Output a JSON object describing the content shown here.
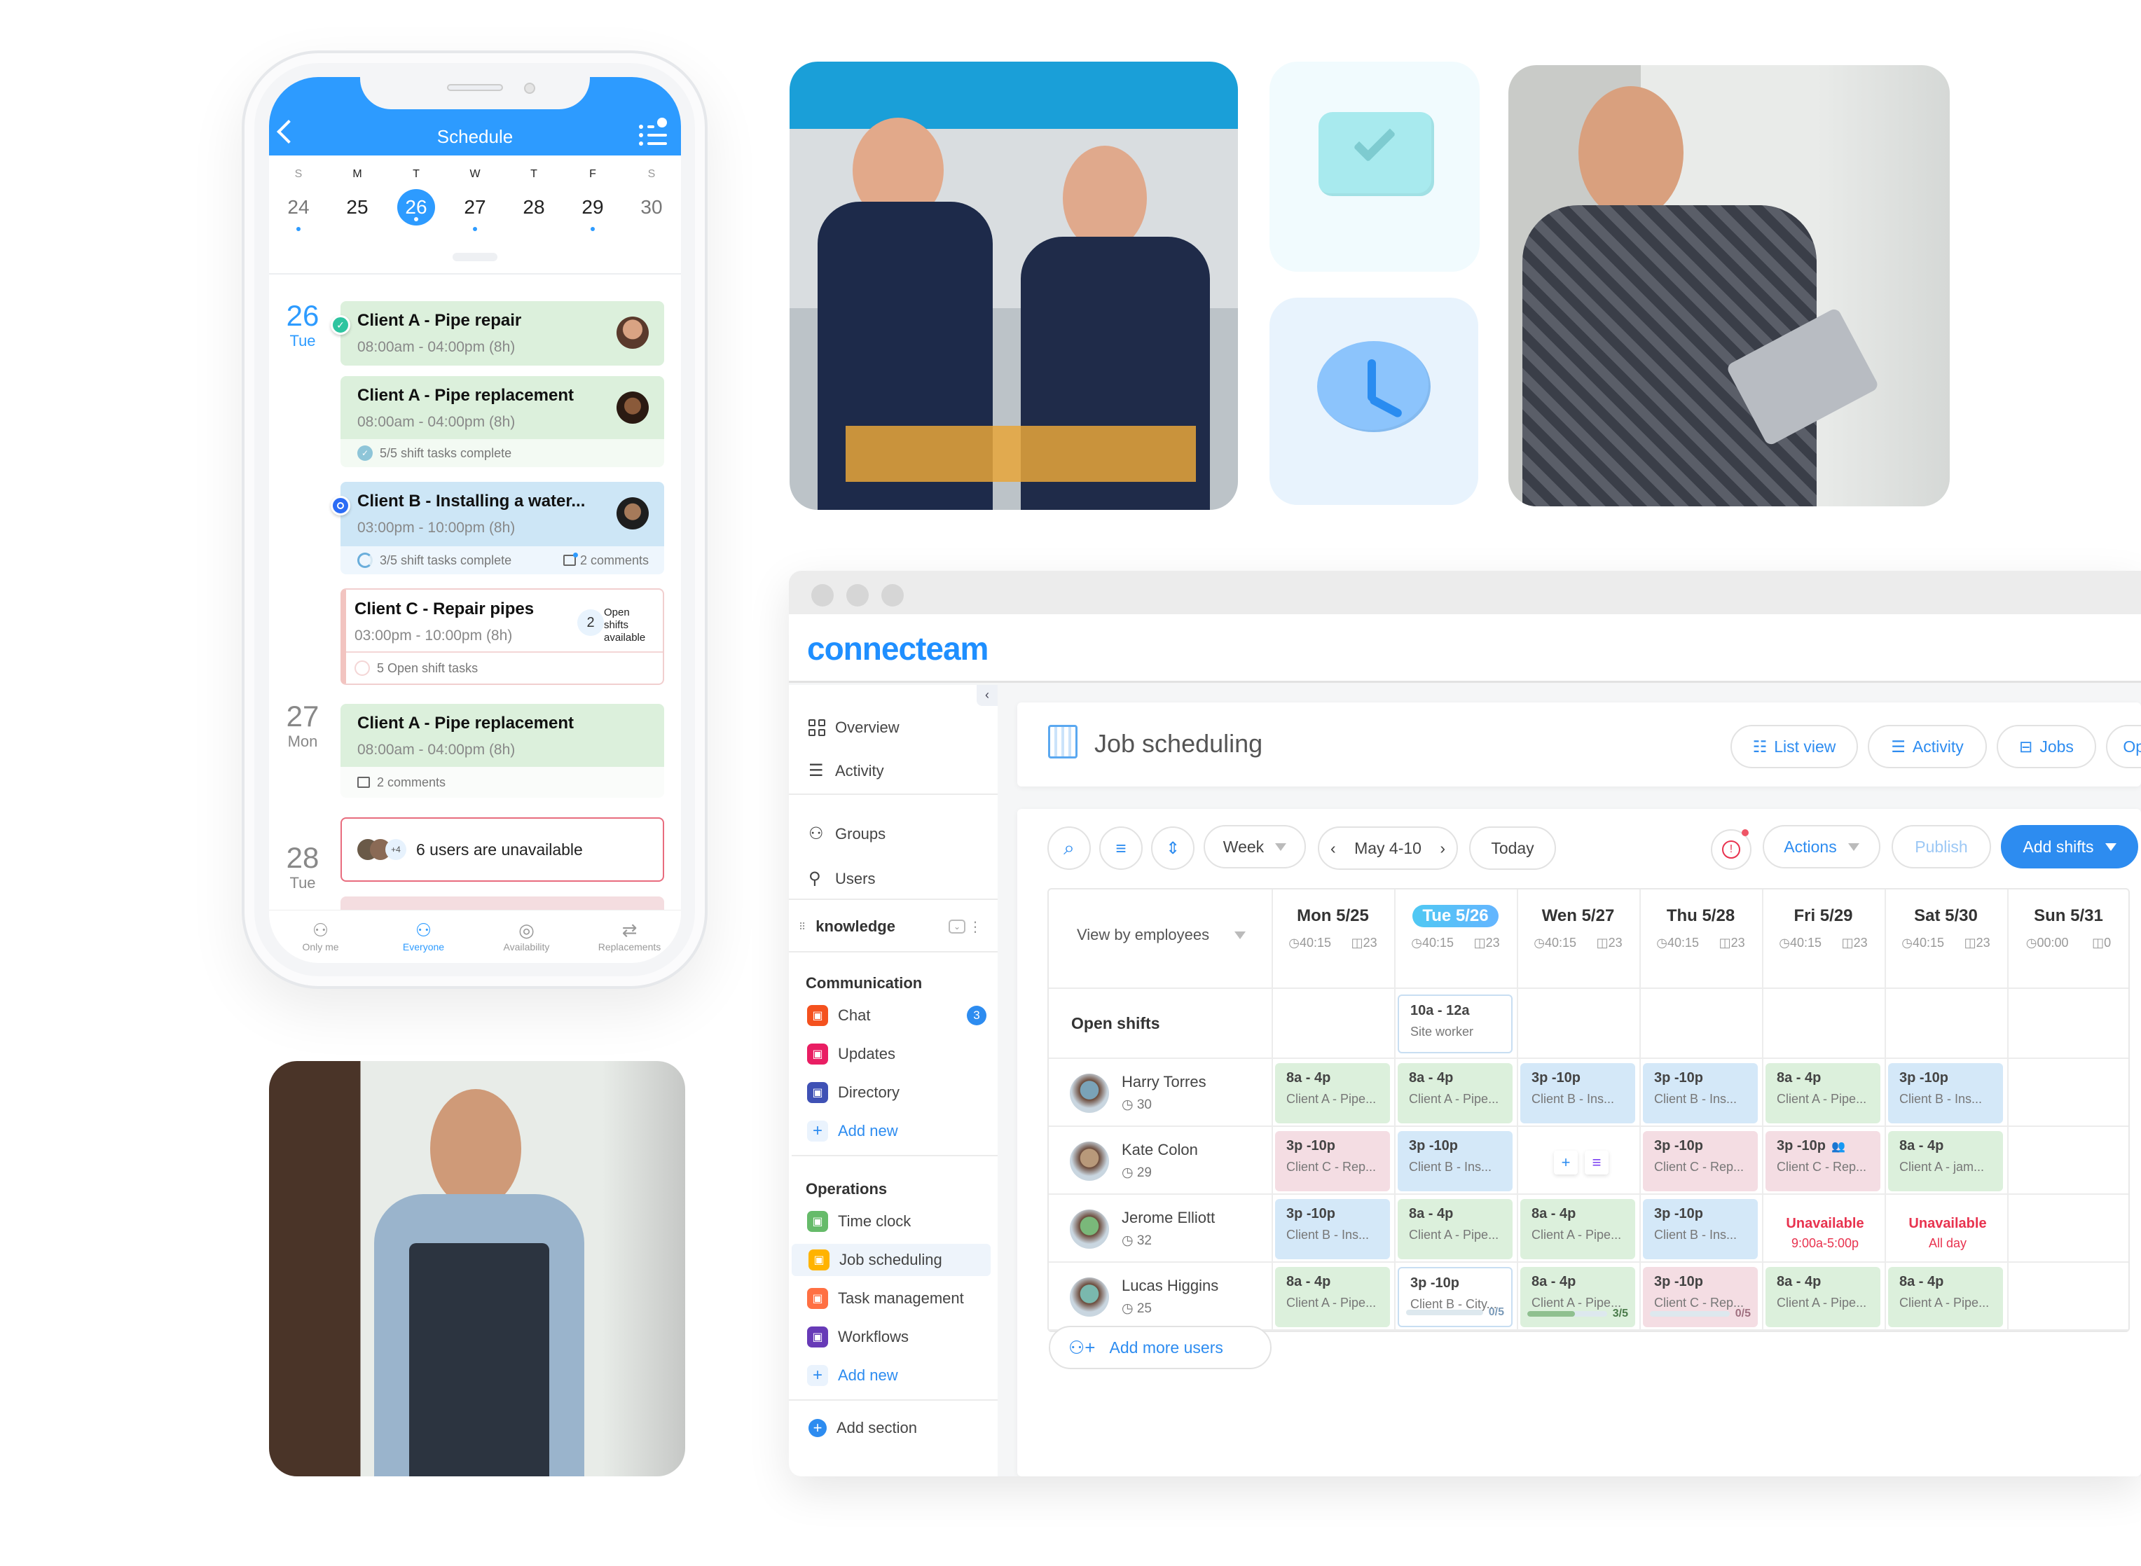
{
  "mobile": {
    "title": "Schedule",
    "icons": {
      "back": "chevron-left-icon",
      "schedule_list": "list-clock-icon"
    },
    "week": {
      "letters": [
        "S",
        "M",
        "T",
        "W",
        "T",
        "F",
        "S"
      ],
      "days": [
        "24",
        "25",
        "26",
        "27",
        "28",
        "29",
        "30"
      ],
      "selected_day": "26",
      "days_with_events": [
        "24",
        "26",
        "27",
        "29"
      ]
    },
    "groups": [
      {
        "day": "26",
        "weekday": "Tue",
        "cards": [
          {
            "title": "Client A - Pipe repair",
            "time": "08:00am - 04:00pm (8h)",
            "color": "green",
            "status": "checked"
          },
          {
            "title": "Client A - Pipe replacement",
            "time": "08:00am - 04:00pm (8h)",
            "color": "green",
            "footer": "5/5 shift tasks complete"
          },
          {
            "title": "Client B - Installing a water...",
            "time": "03:00pm - 10:00pm (8h)",
            "color": "blue",
            "status": "in-progress",
            "footer": "3/5 shift tasks complete",
            "comments": "2 comments"
          },
          {
            "title": "Client C - Repair pipes",
            "time": "03:00pm - 10:00pm (8h)",
            "color": "open",
            "open_count": "2",
            "open_label": "Open shifts available",
            "footer": "5 Open shift tasks"
          }
        ]
      },
      {
        "day": "27",
        "weekday": "Mon",
        "cards": [
          {
            "title": "Client A - Pipe replacement",
            "time": "08:00am - 04:00pm (8h)",
            "color": "green",
            "comments": "2 comments"
          }
        ]
      },
      {
        "day": "28",
        "weekday": "Tue",
        "cards": [
          {
            "title": "6 users are unavailable",
            "extra_count": "+4",
            "color": "unavailable"
          }
        ]
      }
    ],
    "tabs": [
      {
        "label": "Only me",
        "icon": "user-icon",
        "active": false
      },
      {
        "label": "Everyone",
        "icon": "users-icon",
        "active": true
      },
      {
        "label": "Availability",
        "icon": "check-circle-icon",
        "active": false
      },
      {
        "label": "Replacements",
        "icon": "swap-icon",
        "active": false
      }
    ]
  },
  "images": {
    "photo_two_workers": "photo of two workers with tool belts in front of a van",
    "tile_check": "check-icon",
    "tile_clock": "clock-icon",
    "photo_worker_tablet": "photo of worker sitting holding a tablet",
    "photo_worker_door": "photo of smiling worker in overalls at a door"
  },
  "app": {
    "logo": "connecteam",
    "sidebar": {
      "top": [
        {
          "label": "Overview",
          "icon": "grid-icon"
        },
        {
          "label": "Activity",
          "icon": "lines-icon"
        }
      ],
      "people": [
        {
          "label": "Groups",
          "icon": "users-icon"
        },
        {
          "label": "Users",
          "icon": "user-icon"
        }
      ],
      "knowledge": "knowledge",
      "sections": [
        {
          "title": "Communication",
          "items": [
            {
              "label": "Chat",
              "icon": "chat-icon",
              "color": "#f4511e",
              "badge": "3"
            },
            {
              "label": "Updates",
              "icon": "mail-icon",
              "color": "#e91e63"
            },
            {
              "label": "Directory",
              "icon": "directory-icon",
              "color": "#3f51b5"
            }
          ],
          "add_label": "Add new"
        },
        {
          "title": "Operations",
          "items": [
            {
              "label": "Time clock",
              "icon": "stopwatch-icon",
              "color": "#66bb6a"
            },
            {
              "label": "Job scheduling",
              "icon": "calendar-icon",
              "color": "#ffb300",
              "active": true
            },
            {
              "label": "Task management",
              "icon": "task-icon",
              "color": "#ff7043"
            },
            {
              "label": "Workflows",
              "icon": "form-icon",
              "color": "#673ab7"
            }
          ],
          "add_label": "Add new"
        }
      ],
      "add_section": "Add section"
    },
    "page": {
      "title": "Job scheduling",
      "buttons": {
        "list_view": "List view",
        "activity": "Activity",
        "jobs": "Jobs",
        "options": "Options"
      }
    },
    "toolbar": {
      "view": "Week",
      "range": "May 4-10",
      "today": "Today",
      "actions": "Actions",
      "publish": "Publish",
      "add_shifts": "Add shifts"
    },
    "schedule": {
      "view_by": "View by employees",
      "days": [
        {
          "label": "Mon 5/25",
          "hours": "40:15",
          "shifts": "23"
        },
        {
          "label": "Tue 5/26",
          "hours": "40:15",
          "shifts": "23",
          "today": true
        },
        {
          "label": "Wen 5/27",
          "hours": "40:15",
          "shifts": "23"
        },
        {
          "label": "Thu 5/28",
          "hours": "40:15",
          "shifts": "23"
        },
        {
          "label": "Fri  5/29",
          "hours": "40:15",
          "shifts": "23"
        },
        {
          "label": "Sat 5/30",
          "hours": "40:15",
          "shifts": "23"
        },
        {
          "label": "Sun 5/31",
          "hours": "00:00",
          "shifts": "0"
        }
      ],
      "open_shifts_label": "Open shifts",
      "open_shifts": [
        {
          "day": 1,
          "time": "10a - 12a",
          "role": "Site worker"
        }
      ],
      "employees": [
        {
          "name": "Harry Torres",
          "hours": "30",
          "cells": [
            {
              "time": "8a - 4p",
              "job": "Client A - Pipe...",
              "color": "green"
            },
            {
              "time": "8a - 4p",
              "job": "Client A - Pipe...",
              "color": "green"
            },
            {
              "time": "3p -10p",
              "job": "Client B - Ins...",
              "color": "blue"
            },
            {
              "time": "3p -10p",
              "job": "Client B - Ins...",
              "color": "blue"
            },
            {
              "time": "8a - 4p",
              "job": "Client A - Pipe...",
              "color": "green"
            },
            {
              "time": "3p -10p",
              "job": "Client B - Ins...",
              "color": "blue"
            },
            null
          ]
        },
        {
          "name": "Kate Colon",
          "hours": "29",
          "cells": [
            {
              "time": "3p -10p",
              "job": "Client C - Rep...",
              "color": "pink"
            },
            {
              "time": "3p -10p",
              "job": "Client B - Ins...",
              "color": "blue"
            },
            {
              "type": "add"
            },
            {
              "time": "3p -10p",
              "job": "Client C - Rep...",
              "color": "pink"
            },
            {
              "time": "3p -10p",
              "job": "Client C - Rep...",
              "color": "pink",
              "group": true
            },
            {
              "time": "8a - 4p",
              "job": "Client A - jam...",
              "color": "green"
            },
            null
          ]
        },
        {
          "name": "Jerome Elliott",
          "hours": "32",
          "cells": [
            {
              "time": "3p -10p",
              "job": "Client B - Ins...",
              "color": "blue"
            },
            {
              "time": "8a - 4p",
              "job": "Client A - Pipe...",
              "color": "green"
            },
            {
              "time": "8a - 4p",
              "job": "Client A - Pipe...",
              "color": "green"
            },
            {
              "time": "3p -10p",
              "job": "Client B - Ins...",
              "color": "blue"
            },
            {
              "type": "unavailable",
              "label": "Unavailable",
              "detail": "9:00a-5:00p"
            },
            {
              "type": "unavailable",
              "label": "Unavailable",
              "detail": "All day"
            },
            null
          ]
        },
        {
          "name": "Lucas Higgins",
          "hours": "25",
          "cells": [
            {
              "time": "8a - 4p",
              "job": "Client A - Pipe...",
              "color": "green"
            },
            {
              "time": "3p -10p",
              "job": "Client B - City...",
              "color": "white",
              "tasks": "0/5",
              "progress": 0
            },
            {
              "time": "8a - 4p",
              "job": "Client A - Pipe...",
              "color": "green",
              "tasks": "3/5",
              "progress": 0.6
            },
            {
              "time": "3p -10p",
              "job": "Client C - Rep...",
              "color": "pink",
              "tasks": "0/5",
              "progress": 0
            },
            {
              "time": "8a - 4p",
              "job": "Client A - Pipe...",
              "color": "green"
            },
            {
              "time": "8a - 4p",
              "job": "Client A - Pipe...",
              "color": "green"
            },
            null
          ]
        }
      ],
      "add_users": "Add more users"
    }
  }
}
